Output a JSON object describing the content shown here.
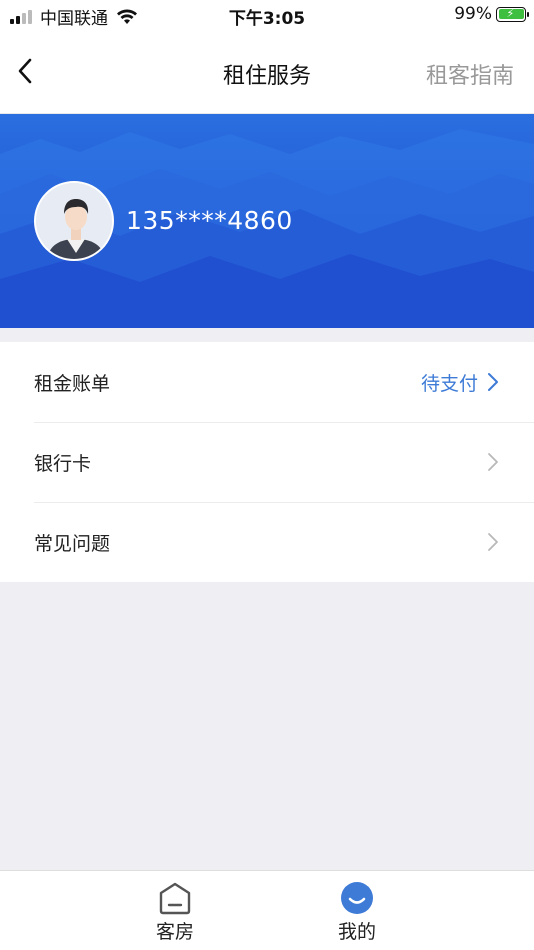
{
  "status_bar": {
    "carrier": "中国联通",
    "time": "下午3:05",
    "battery": "99%"
  },
  "nav": {
    "title": "租住服务",
    "guide_label": "租客指南"
  },
  "profile": {
    "phone": "135****4860"
  },
  "menu": {
    "items": [
      {
        "label": "租金账单",
        "status": "待支付"
      },
      {
        "label": "银行卡",
        "status": ""
      },
      {
        "label": "常见问题",
        "status": ""
      }
    ]
  },
  "tabs": [
    {
      "label": "客房",
      "icon": "house-icon",
      "active": false
    },
    {
      "label": "我的",
      "icon": "smile-icon",
      "active": true
    }
  ],
  "colors": {
    "accent": "#3d7bd6",
    "banner": "#2459d6",
    "background": "#efeff3"
  }
}
